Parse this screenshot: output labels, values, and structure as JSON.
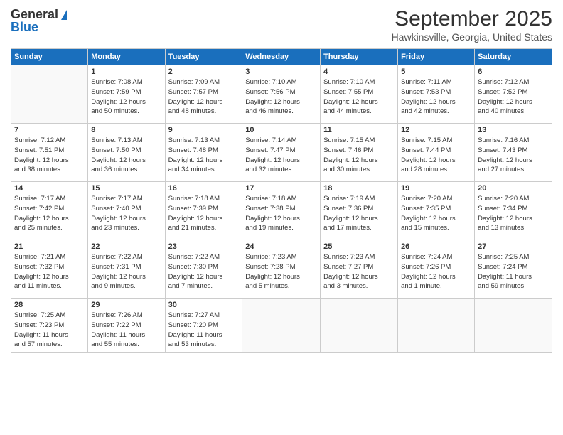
{
  "logo": {
    "line1": "General",
    "line2": "Blue"
  },
  "title": "September 2025",
  "location": "Hawkinsville, Georgia, United States",
  "weekdays": [
    "Sunday",
    "Monday",
    "Tuesday",
    "Wednesday",
    "Thursday",
    "Friday",
    "Saturday"
  ],
  "weeks": [
    [
      {
        "day": "",
        "info": ""
      },
      {
        "day": "1",
        "info": "Sunrise: 7:08 AM\nSunset: 7:59 PM\nDaylight: 12 hours\nand 50 minutes."
      },
      {
        "day": "2",
        "info": "Sunrise: 7:09 AM\nSunset: 7:57 PM\nDaylight: 12 hours\nand 48 minutes."
      },
      {
        "day": "3",
        "info": "Sunrise: 7:10 AM\nSunset: 7:56 PM\nDaylight: 12 hours\nand 46 minutes."
      },
      {
        "day": "4",
        "info": "Sunrise: 7:10 AM\nSunset: 7:55 PM\nDaylight: 12 hours\nand 44 minutes."
      },
      {
        "day": "5",
        "info": "Sunrise: 7:11 AM\nSunset: 7:53 PM\nDaylight: 12 hours\nand 42 minutes."
      },
      {
        "day": "6",
        "info": "Sunrise: 7:12 AM\nSunset: 7:52 PM\nDaylight: 12 hours\nand 40 minutes."
      }
    ],
    [
      {
        "day": "7",
        "info": "Sunrise: 7:12 AM\nSunset: 7:51 PM\nDaylight: 12 hours\nand 38 minutes."
      },
      {
        "day": "8",
        "info": "Sunrise: 7:13 AM\nSunset: 7:50 PM\nDaylight: 12 hours\nand 36 minutes."
      },
      {
        "day": "9",
        "info": "Sunrise: 7:13 AM\nSunset: 7:48 PM\nDaylight: 12 hours\nand 34 minutes."
      },
      {
        "day": "10",
        "info": "Sunrise: 7:14 AM\nSunset: 7:47 PM\nDaylight: 12 hours\nand 32 minutes."
      },
      {
        "day": "11",
        "info": "Sunrise: 7:15 AM\nSunset: 7:46 PM\nDaylight: 12 hours\nand 30 minutes."
      },
      {
        "day": "12",
        "info": "Sunrise: 7:15 AM\nSunset: 7:44 PM\nDaylight: 12 hours\nand 28 minutes."
      },
      {
        "day": "13",
        "info": "Sunrise: 7:16 AM\nSunset: 7:43 PM\nDaylight: 12 hours\nand 27 minutes."
      }
    ],
    [
      {
        "day": "14",
        "info": "Sunrise: 7:17 AM\nSunset: 7:42 PM\nDaylight: 12 hours\nand 25 minutes."
      },
      {
        "day": "15",
        "info": "Sunrise: 7:17 AM\nSunset: 7:40 PM\nDaylight: 12 hours\nand 23 minutes."
      },
      {
        "day": "16",
        "info": "Sunrise: 7:18 AM\nSunset: 7:39 PM\nDaylight: 12 hours\nand 21 minutes."
      },
      {
        "day": "17",
        "info": "Sunrise: 7:18 AM\nSunset: 7:38 PM\nDaylight: 12 hours\nand 19 minutes."
      },
      {
        "day": "18",
        "info": "Sunrise: 7:19 AM\nSunset: 7:36 PM\nDaylight: 12 hours\nand 17 minutes."
      },
      {
        "day": "19",
        "info": "Sunrise: 7:20 AM\nSunset: 7:35 PM\nDaylight: 12 hours\nand 15 minutes."
      },
      {
        "day": "20",
        "info": "Sunrise: 7:20 AM\nSunset: 7:34 PM\nDaylight: 12 hours\nand 13 minutes."
      }
    ],
    [
      {
        "day": "21",
        "info": "Sunrise: 7:21 AM\nSunset: 7:32 PM\nDaylight: 12 hours\nand 11 minutes."
      },
      {
        "day": "22",
        "info": "Sunrise: 7:22 AM\nSunset: 7:31 PM\nDaylight: 12 hours\nand 9 minutes."
      },
      {
        "day": "23",
        "info": "Sunrise: 7:22 AM\nSunset: 7:30 PM\nDaylight: 12 hours\nand 7 minutes."
      },
      {
        "day": "24",
        "info": "Sunrise: 7:23 AM\nSunset: 7:28 PM\nDaylight: 12 hours\nand 5 minutes."
      },
      {
        "day": "25",
        "info": "Sunrise: 7:23 AM\nSunset: 7:27 PM\nDaylight: 12 hours\nand 3 minutes."
      },
      {
        "day": "26",
        "info": "Sunrise: 7:24 AM\nSunset: 7:26 PM\nDaylight: 12 hours\nand 1 minute."
      },
      {
        "day": "27",
        "info": "Sunrise: 7:25 AM\nSunset: 7:24 PM\nDaylight: 11 hours\nand 59 minutes."
      }
    ],
    [
      {
        "day": "28",
        "info": "Sunrise: 7:25 AM\nSunset: 7:23 PM\nDaylight: 11 hours\nand 57 minutes."
      },
      {
        "day": "29",
        "info": "Sunrise: 7:26 AM\nSunset: 7:22 PM\nDaylight: 11 hours\nand 55 minutes."
      },
      {
        "day": "30",
        "info": "Sunrise: 7:27 AM\nSunset: 7:20 PM\nDaylight: 11 hours\nand 53 minutes."
      },
      {
        "day": "",
        "info": ""
      },
      {
        "day": "",
        "info": ""
      },
      {
        "day": "",
        "info": ""
      },
      {
        "day": "",
        "info": ""
      }
    ]
  ]
}
